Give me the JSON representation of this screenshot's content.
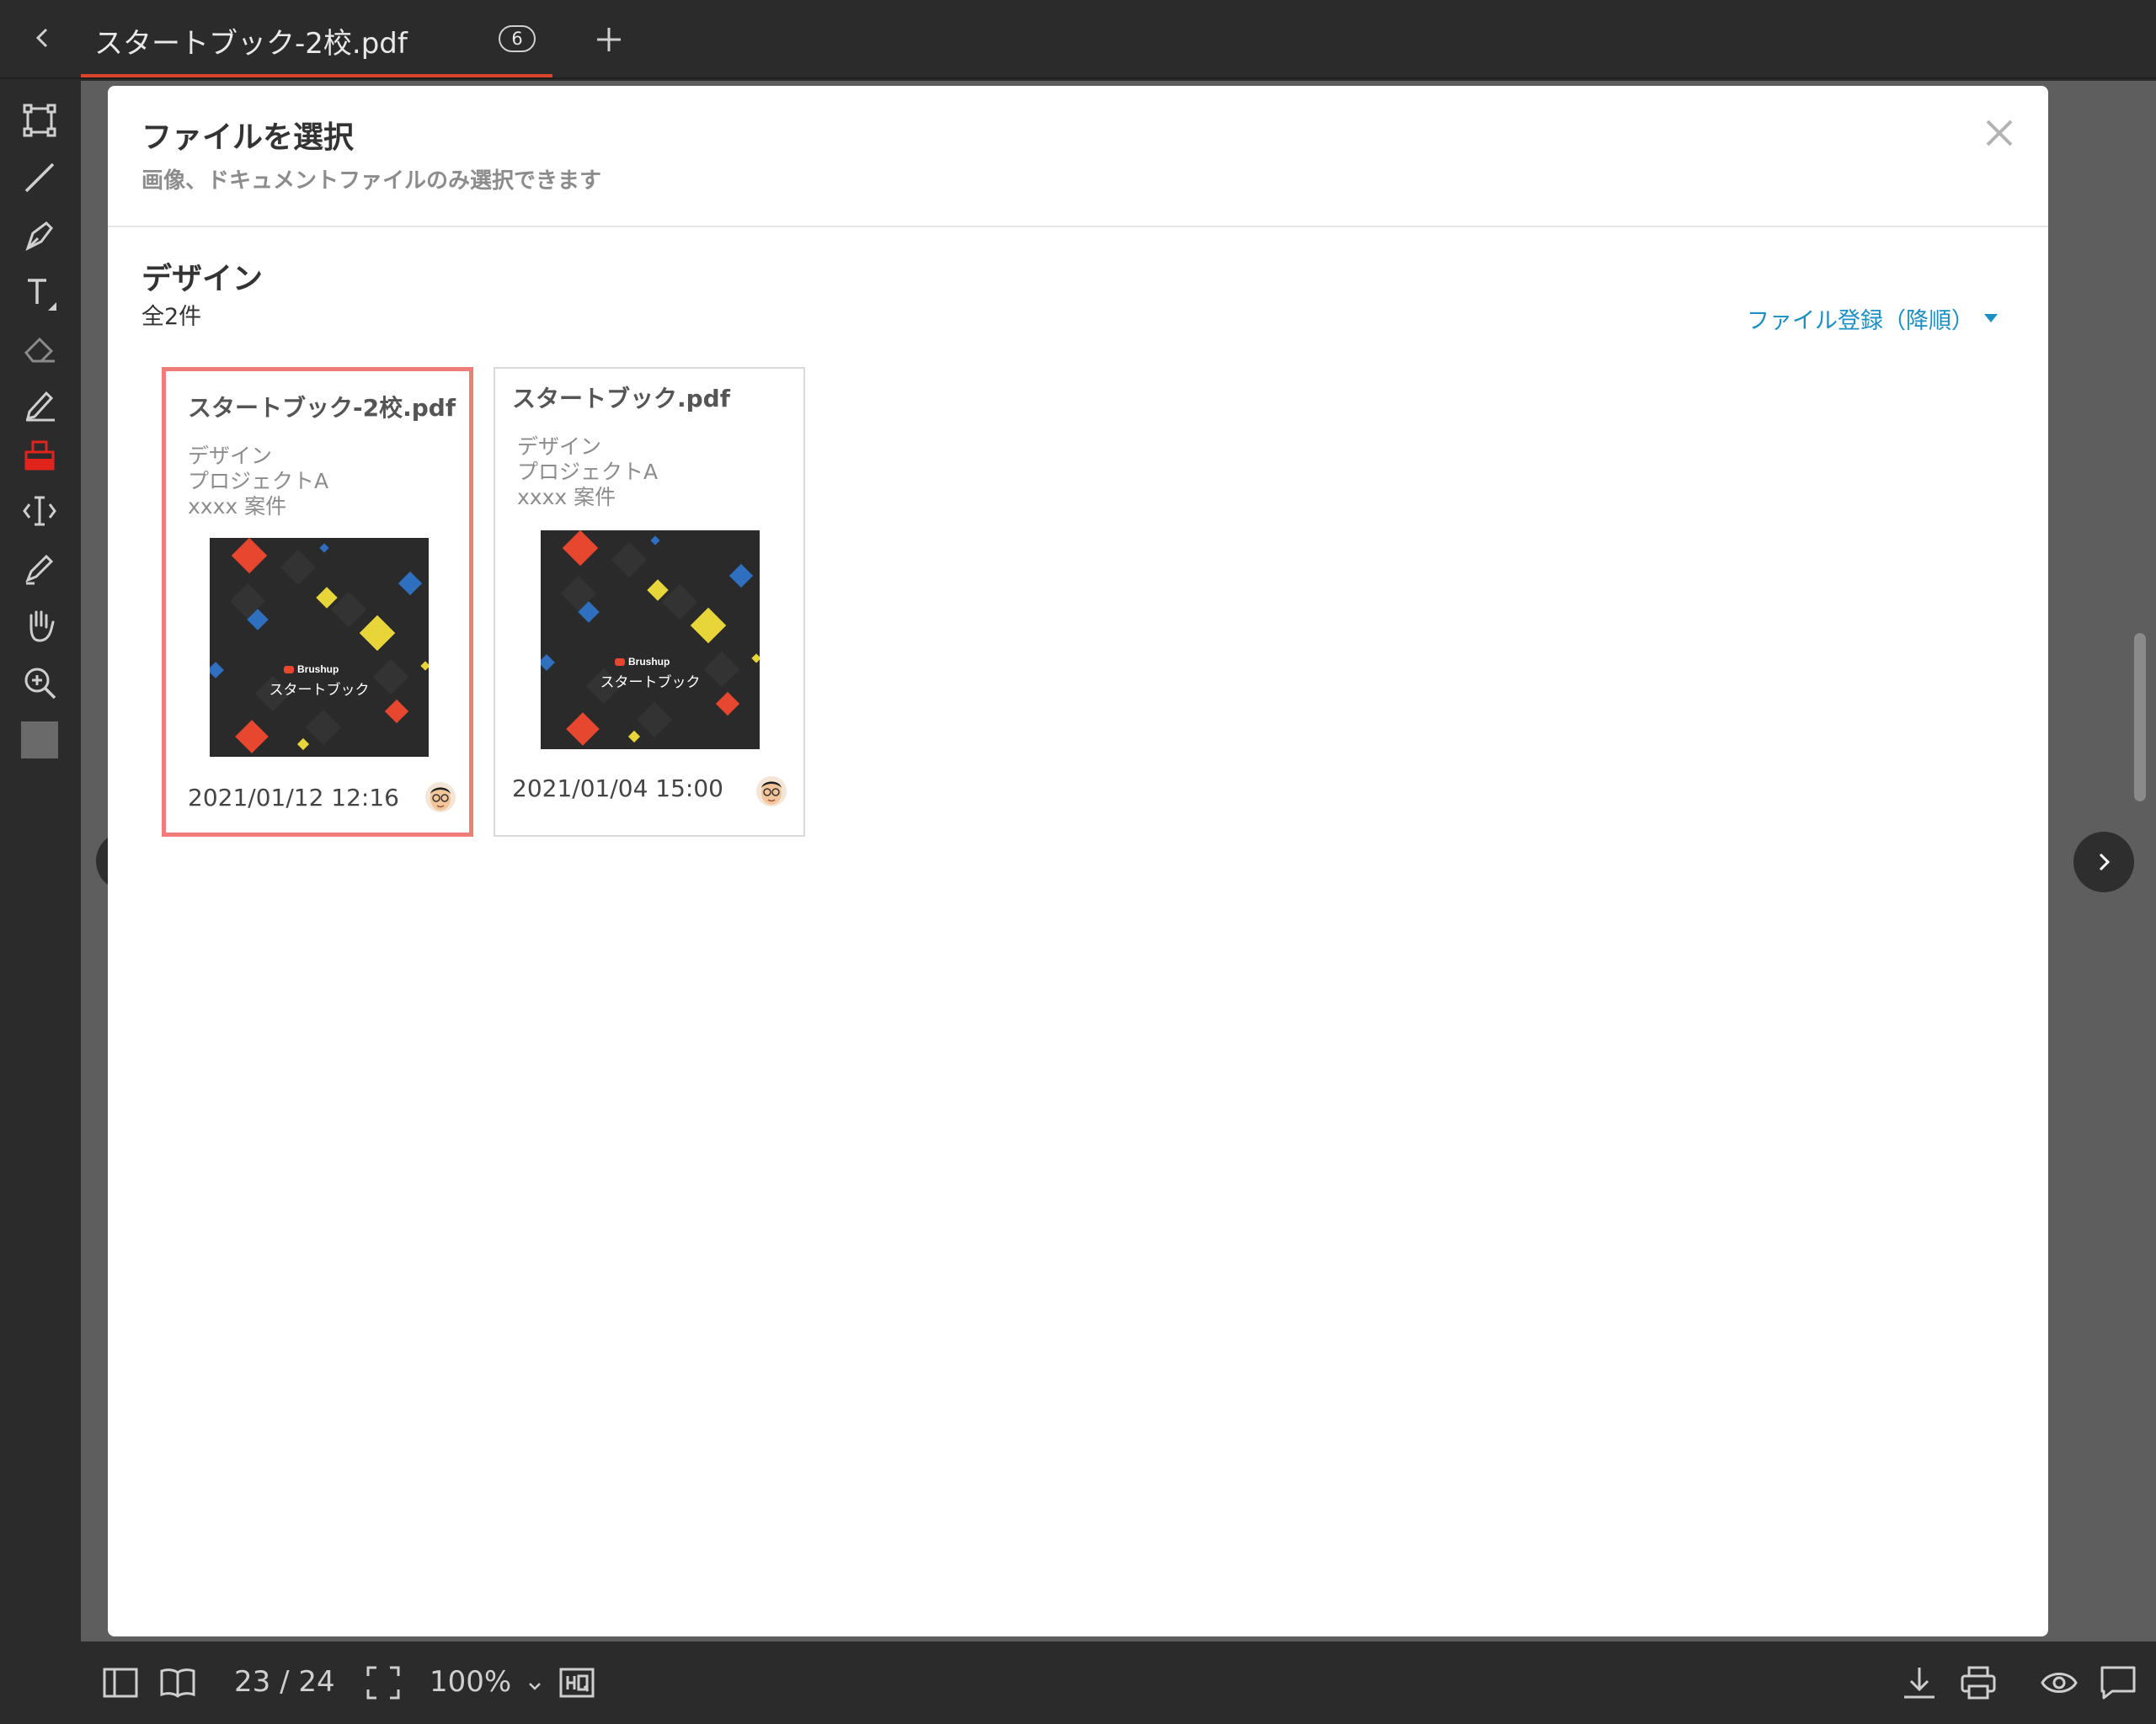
{
  "tab": {
    "file_name": "スタートブック-2校.pdf",
    "version": "6"
  },
  "modal": {
    "title": "ファイルを選択",
    "subtitle": "画像、ドキュメントファイルのみ選択できます"
  },
  "folder": {
    "name": "デザイン",
    "count": "全2件",
    "sort_label": "ファイル登録（降順）"
  },
  "files": [
    {
      "name": "スタートブック-2校.pdf",
      "folder": "デザイン",
      "project": "プロジェクトA",
      "case": "xxxx 案件",
      "date": "2021/01/12 12:16",
      "thumb_brand": "Brushup",
      "thumb_title": "スタートブック",
      "selected": true
    },
    {
      "name": "スタートブック.pdf",
      "folder": "デザイン",
      "project": "プロジェクトA",
      "case": "xxxx 案件",
      "date": "2021/01/04 15:00",
      "thumb_brand": "Brushup",
      "thumb_title": "スタートブック",
      "selected": false
    }
  ],
  "bottombar": {
    "page": "23 / 24",
    "zoom": "100%"
  },
  "colors": {
    "accent": "#d9442b",
    "link": "#1a8fc4",
    "selected_border": "#f07d7a",
    "active_tool": "#e0241b"
  },
  "icons": {
    "toolbar": [
      "rectangle-icon",
      "line-icon",
      "pen-icon",
      "text-icon",
      "eraser-icon",
      "edit-pencil-icon",
      "stamp-icon",
      "text-cursor-icon",
      "highlighter-icon",
      "hand-icon",
      "zoom-in-icon",
      "color-swatch-icon"
    ],
    "bottombar": [
      "sidebar-icon",
      "book-icon",
      "fullscreen-icon",
      "hq-icon",
      "download-icon",
      "print-icon",
      "eye-icon",
      "comment-icon"
    ]
  }
}
